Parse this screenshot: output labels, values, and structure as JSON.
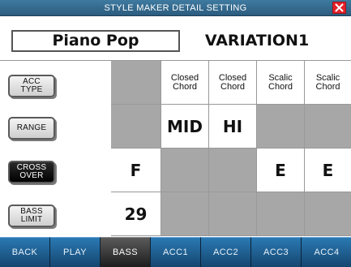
{
  "header": {
    "title": "STYLE MAKER DETAIL SETTING"
  },
  "style": {
    "name": "Piano Pop",
    "variation": "VARIATION1"
  },
  "side_buttons": [
    {
      "label": "ACC\nTYPE",
      "active": false
    },
    {
      "label": "RANGE",
      "active": false
    },
    {
      "label": "CROSS\nOVER",
      "active": true
    },
    {
      "label": "BASS\nLIMIT",
      "active": false
    }
  ],
  "grid": {
    "row_acc_type": [
      "",
      "Closed\nChord",
      "Closed\nChord",
      "Scalic\nChord",
      "Scalic\nChord"
    ],
    "row_range": [
      "",
      "MID",
      "HI",
      "",
      ""
    ],
    "row_cross_over": [
      "F",
      "",
      "",
      "E",
      "E"
    ],
    "row_bass_limit": [
      "29",
      "",
      "",
      "",
      ""
    ]
  },
  "tabs": [
    "BACK",
    "PLAY",
    "BASS",
    "ACC1",
    "ACC2",
    "ACC3",
    "ACC4"
  ],
  "active_tab": "BASS",
  "colors": {
    "title_bar": "#2f6a92",
    "close": "#e4232b",
    "cell_gray": "#a7a7a7",
    "tab_blue": "#1f5f93",
    "tab_active": "#3a3a3a"
  }
}
